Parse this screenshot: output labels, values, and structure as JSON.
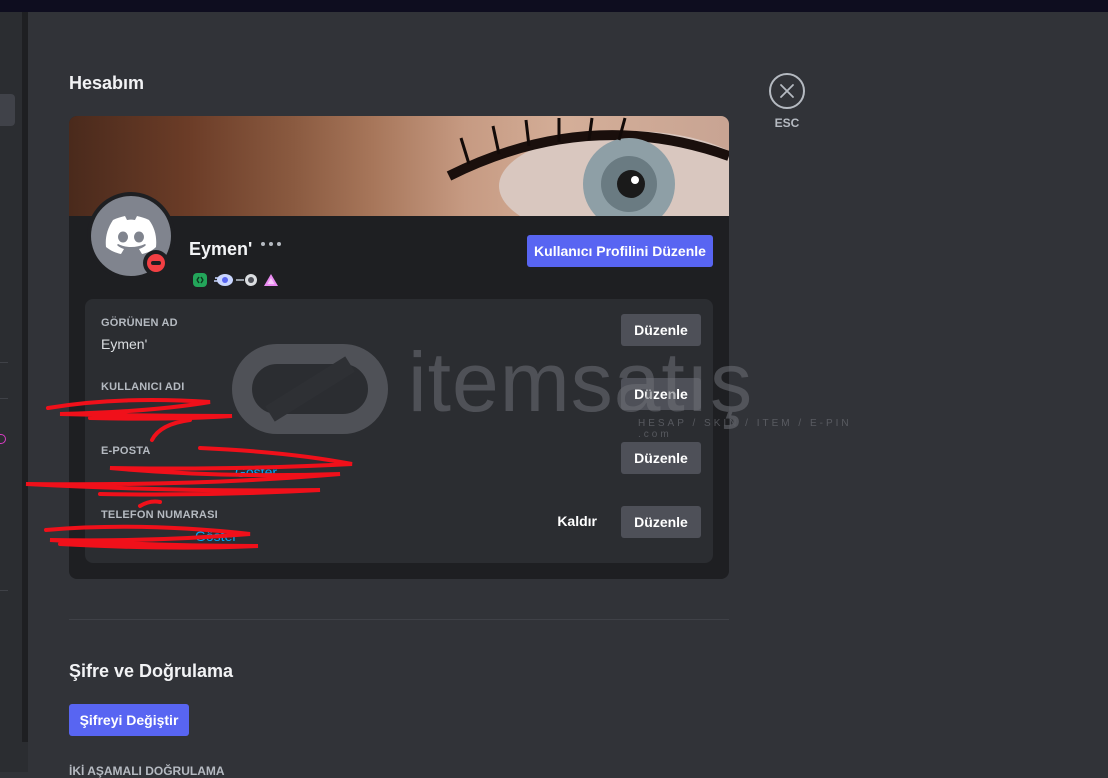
{
  "page": {
    "title": "Hesabım",
    "close_label": "ESC"
  },
  "profile": {
    "username": "Eymen'",
    "more_icon": "more-horizontal-icon",
    "edit_profile_label": "Kullanıcı Profilini Düzenle",
    "status": "do-not-disturb",
    "badges": [
      "active-developer-badge",
      "nitro-badge",
      "boost-badge",
      "hypesquad-badge"
    ]
  },
  "fields": [
    {
      "label": "GÖRÜNEN AD",
      "value": "Eymen'",
      "edit_label": "Düzenle"
    },
    {
      "label": "KULLANICI ADI",
      "value": "",
      "edit_label": "Düzenle"
    },
    {
      "label": "E-POSTA",
      "value": "",
      "reveal_label": "Göster",
      "edit_label": "Düzenle"
    },
    {
      "label": "TELEFON NUMARASI",
      "value": "",
      "remove_label": "Kaldır",
      "reveal_label": "Göster",
      "edit_label": "Düzenle"
    }
  ],
  "password": {
    "title": "Şifre ve Doğrulama",
    "change_label": "Şifreyi Değiştir",
    "two_factor_heading": "İKİ AŞAMALI DOĞRULAMA"
  },
  "watermark": {
    "name": "itemsatış",
    "tagline": "HESAP / SKIN / ITEM / E-PIN .com"
  },
  "colors": {
    "brand": "#5865f2",
    "background": "#313338",
    "card": "#1e1f22",
    "dnd": "#f23f43"
  }
}
